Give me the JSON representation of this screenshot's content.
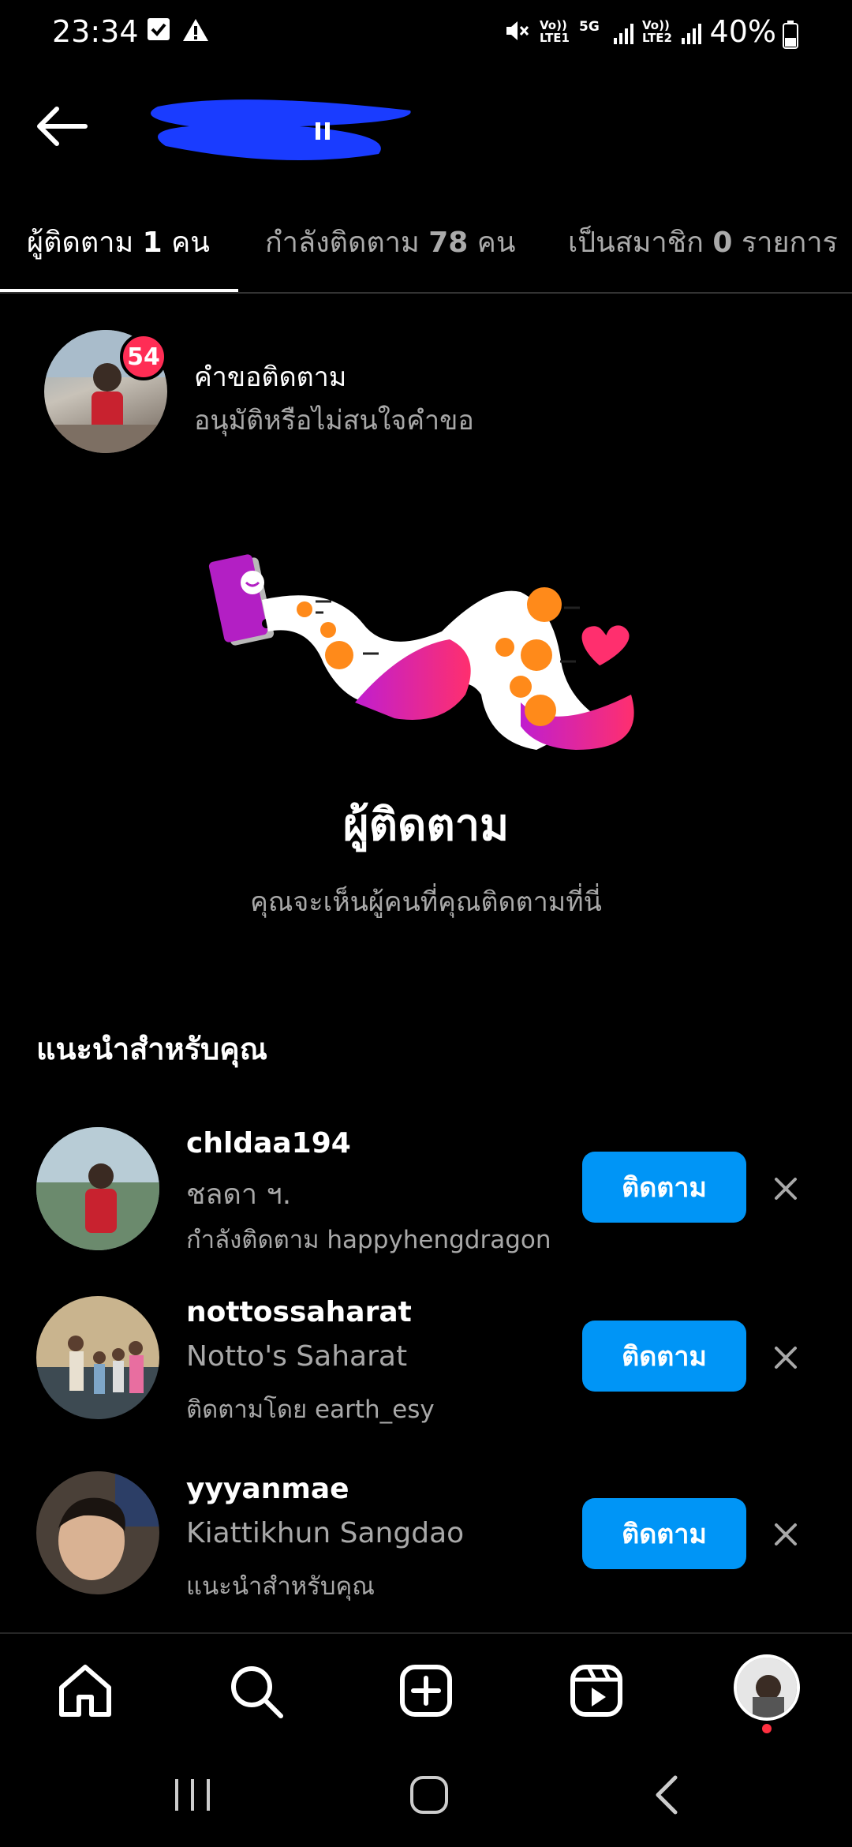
{
  "status_bar": {
    "time": "23:34",
    "battery": "40%",
    "icons": [
      "check-notification-icon",
      "warning-icon",
      "mute-icon",
      "volte-lte1-icon",
      "5g-icon",
      "signal-icon",
      "volte-lte2-icon",
      "signal-icon",
      "battery-icon"
    ],
    "volte1_top": "Vo))",
    "volte1_bottom": "LTE1",
    "fiveg": "5G",
    "volte2_top": "Vo))",
    "volte2_bottom": "LTE2"
  },
  "tabs": [
    {
      "label": "ผู้ติดตาม",
      "count": "1",
      "unit": "คน",
      "active": true
    },
    {
      "label": "กำลังติดตาม",
      "count": "78",
      "unit": "คน",
      "active": false
    },
    {
      "label": "เป็นสมาชิก",
      "count": "0",
      "unit": "รายการ",
      "active": false
    }
  ],
  "follow_requests": {
    "badge": "54",
    "title": "คำขอติดตาม",
    "subtitle": "อนุมัติหรือไม่สนใจคำขอ"
  },
  "empty_state": {
    "title": "ผู้ติดตาม",
    "subtitle": "คุณจะเห็นผู้คนที่คุณติดตามที่นี่"
  },
  "suggestions": {
    "heading": "แนะนำสำหรับคุณ",
    "items": [
      {
        "username": "chldaa194",
        "name": "ชลดา ฯ.",
        "context": "กำลังติดตาม happyhengdragon",
        "button": "ติดตาม"
      },
      {
        "username": "nottossaharat",
        "name": "Notto's Saharat",
        "context": "ติดตามโดย earth_esy",
        "button": "ติดตาม"
      },
      {
        "username": "yyyanmae",
        "name": "Kiattikhun Sangdao",
        "context": "แนะนำสำหรับคุณ",
        "button": "ติดตาม"
      }
    ]
  },
  "colors": {
    "accent": "#0095f6",
    "badge": "#ff2d55",
    "redaction": "#1a3cff"
  }
}
